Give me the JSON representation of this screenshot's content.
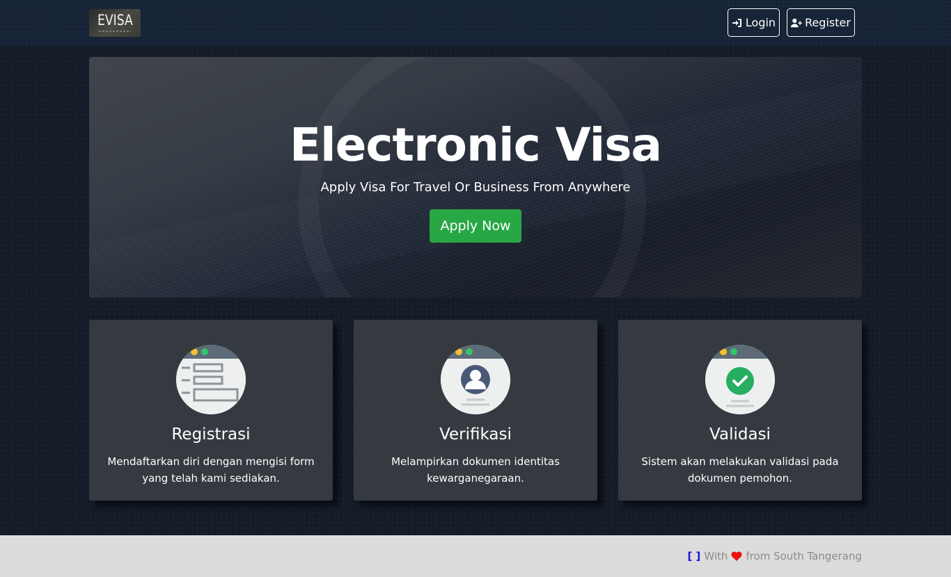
{
  "navbar": {
    "brand": "EVISA",
    "login_label": "Login",
    "register_label": "Register"
  },
  "hero": {
    "title": "Electronic Visa",
    "subtitle": "Apply Visa For Travel Or Business From Anywhere",
    "cta_label": "Apply Now",
    "cta_color": "#28a745"
  },
  "cards": [
    {
      "title": "Registrasi",
      "text": "Mendaftarkan diri dengan mengisi form yang telah kami sediakan.",
      "icon": "registration-form-icon"
    },
    {
      "title": "Verifikasi",
      "text": "Melampirkan dokumen identitas kewarganegaraan.",
      "icon": "user-verification-icon"
    },
    {
      "title": "Validasi",
      "text": "Sistem akan melakukan validasi pada dokumen pemohon.",
      "icon": "validation-check-icon"
    }
  ],
  "footer": {
    "bracket": "[ ]",
    "with": "With",
    "from": "from South Tangerang",
    "heart_color": "#ee1111"
  }
}
